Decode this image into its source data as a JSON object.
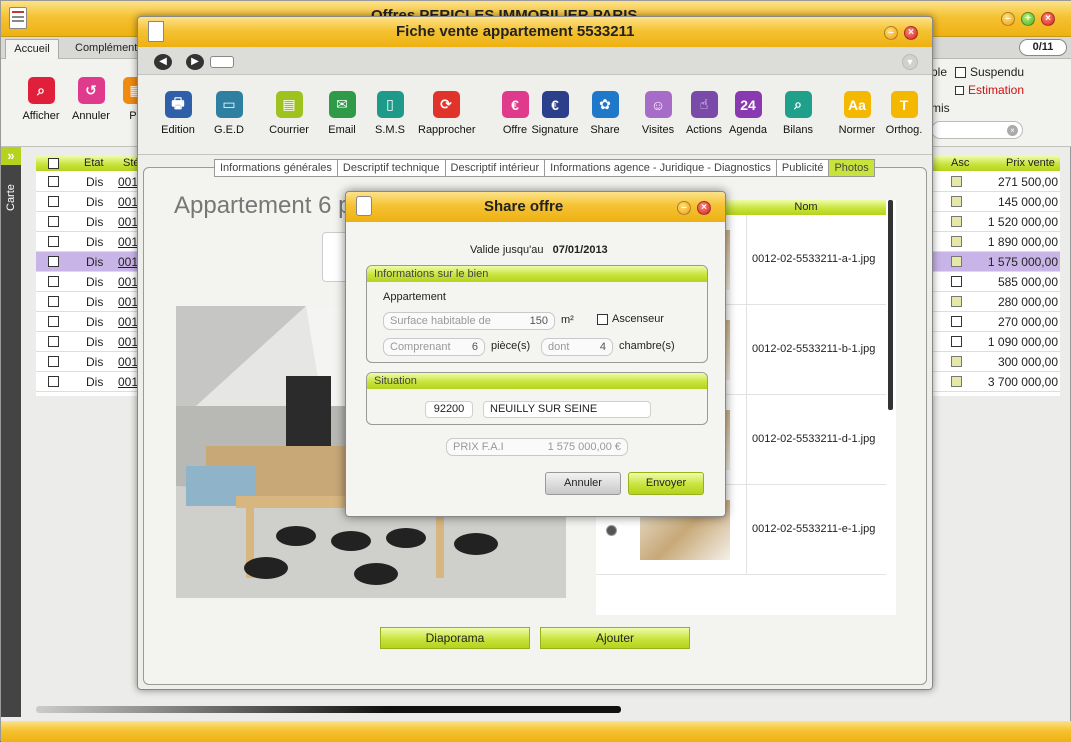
{
  "main_window": {
    "title": "Offres  PERICLES IMMOBILIER PARIS",
    "tabs": [
      "Accueil",
      "Complément"
    ],
    "counter": "0/11",
    "toolbar": [
      "Afficher",
      "Annuler",
      "Pa"
    ],
    "right_options": {
      "opt1": "ple",
      "suspendu": "Suspendu",
      "estimation": "Estimation",
      "mis": "mis"
    },
    "sidebar_label": "Carte",
    "grid": {
      "col_etat": "Etat",
      "col_ste": "Sté",
      "col_asc": "Asc",
      "col_prix": "Prix vente",
      "rows": [
        {
          "etat": "Dis",
          "ref": "0012",
          "price": "271 500,00",
          "asc": true
        },
        {
          "etat": "Dis",
          "ref": "0012",
          "price": "145 000,00",
          "asc": true
        },
        {
          "etat": "Dis",
          "ref": "0012",
          "price": "1 520 000,00",
          "asc": true
        },
        {
          "etat": "Dis",
          "ref": "0012",
          "price": "1 890 000,00",
          "asc": true
        },
        {
          "etat": "Dis",
          "ref": "0012",
          "price": "1 575 000,00",
          "asc": true
        },
        {
          "etat": "Dis",
          "ref": "0012",
          "price": "585 000,00",
          "asc": false
        },
        {
          "etat": "Dis",
          "ref": "0012",
          "price": "280 000,00",
          "asc": true
        },
        {
          "etat": "Dis",
          "ref": "0012",
          "price": "270 000,00",
          "asc": false
        },
        {
          "etat": "Dis",
          "ref": "0012",
          "price": "1 090 000,00",
          "asc": false
        },
        {
          "etat": "Dis",
          "ref": "0012",
          "price": "300 000,00",
          "asc": true
        },
        {
          "etat": "Dis",
          "ref": "0012",
          "price": "3 700 000,00",
          "asc": true
        }
      ]
    }
  },
  "fiche_window": {
    "title": "Fiche vente appartement 5533211",
    "toolbar": [
      {
        "label": "Edition",
        "icon": "printer-icon",
        "color": "#2f5fa8",
        "glyph": "🖶"
      },
      {
        "label": "G.E.D",
        "icon": "folder-icon",
        "color": "#2f7fa0",
        "glyph": "▭"
      },
      {
        "label": "Courrier",
        "icon": "id-card-icon",
        "color": "#9ec21e",
        "glyph": "▤"
      },
      {
        "label": "Email",
        "icon": "envelope-icon",
        "color": "#2f9a48",
        "glyph": "✉"
      },
      {
        "label": "S.M.S",
        "icon": "phone-icon",
        "color": "#1e9a8a",
        "glyph": "▯"
      },
      {
        "label": "Rapprocher",
        "icon": "sync-icon",
        "color": "#e0332a",
        "glyph": "⟳"
      },
      {
        "label": "Offre",
        "icon": "euro-tag-icon",
        "color": "#e03a8c",
        "glyph": "€"
      },
      {
        "label": "Signature",
        "icon": "euro-icon",
        "color": "#2c3f8a",
        "glyph": "€"
      },
      {
        "label": "Share",
        "icon": "share-icon",
        "color": "#1f78c8",
        "glyph": "✿"
      },
      {
        "label": "Visites",
        "icon": "people-icon",
        "color": "#a66cc8",
        "glyph": "☺"
      },
      {
        "label": "Actions",
        "icon": "hand-icon",
        "color": "#7a4aa8",
        "glyph": "☝"
      },
      {
        "label": "Agenda",
        "icon": "calendar-icon",
        "color": "#8a3ab0",
        "glyph": "24"
      },
      {
        "label": "Bilans",
        "icon": "search-doc-icon",
        "color": "#1ea08a",
        "glyph": "⌕"
      },
      {
        "label": "Normer",
        "icon": "font-icon",
        "color": "#f4b800",
        "glyph": "Aa"
      },
      {
        "label": "Orthog.",
        "icon": "spell-icon",
        "color": "#f4b800",
        "glyph": "T"
      }
    ],
    "tabs": [
      "Informations générales",
      "Descriptif technique",
      "Descriptif intérieur",
      "Informations agence - Juridique - Diagnostics",
      "Publicité",
      "Photos"
    ],
    "heading": "Appartement 6 p",
    "photo_col_header": "Nom",
    "photos": [
      "0012-02-5533211-a-1.jpg",
      "0012-02-5533211-b-1.jpg",
      "0012-02-5533211-d-1.jpg",
      "0012-02-5533211-e-1.jpg"
    ],
    "btn_diaporama": "Diaporama",
    "btn_ajouter": "Ajouter"
  },
  "share_dialog": {
    "title": "Share offre",
    "valid_label": "Valide jusqu'au",
    "valid_date": "07/01/2013",
    "section_bien": "Informations sur le bien",
    "type": "Appartement",
    "surface_label": "Surface habitable de",
    "surface_value": "150",
    "surface_unit": "m²",
    "ascenseur": "Ascenseur",
    "comprenant_label": "Comprenant",
    "pieces_value": "6",
    "pieces_unit": "pièce(s)",
    "dont_label": "dont",
    "chambres_value": "4",
    "chambres_unit": "chambre(s)",
    "section_situation": "Situation",
    "postal_code": "92200",
    "city": "NEUILLY SUR SEINE",
    "prix_label": "PRIX F.A.I",
    "prix_value": "1 575 000,00 €",
    "btn_annuler": "Annuler",
    "btn_envoyer": "Envoyer"
  }
}
